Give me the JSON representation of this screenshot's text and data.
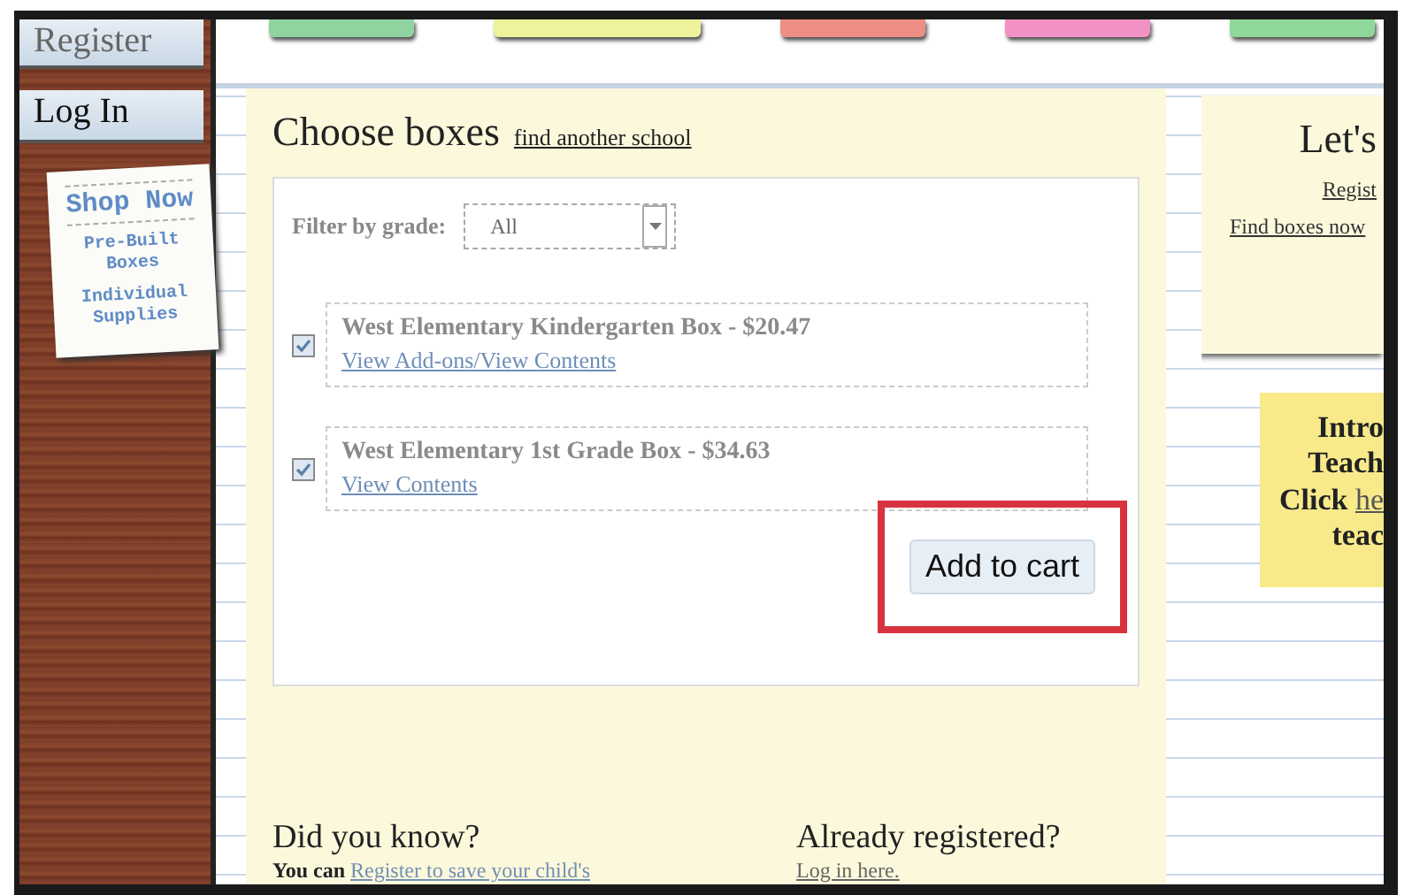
{
  "top_tabs": [
    {
      "color": "#8fd4a0"
    },
    {
      "color": "#eef29a"
    },
    {
      "color": "#ee8f86"
    },
    {
      "color": "#f191c4"
    },
    {
      "color": "#8fd89a"
    }
  ],
  "sidebar": {
    "buttons": [
      "Register",
      "Log In"
    ],
    "shop_card": {
      "title": "Shop Now",
      "links": [
        "Pre-Built Boxes",
        "Individual Supplies"
      ]
    }
  },
  "main": {
    "title": "Choose boxes",
    "title_link": "find another school",
    "filter": {
      "label": "Filter by grade:",
      "value": "All"
    },
    "items": [
      {
        "name": "West Elementary Kindergarten Box - $20.47",
        "link": "View Add-ons/View Contents",
        "checked": true
      },
      {
        "name": "West Elementary 1st Grade Box - $34.63",
        "link": "View Contents",
        "checked": true
      }
    ],
    "button": {
      "label": "Add to cart",
      "highlighted": true
    },
    "info": [
      {
        "heading": "Did you know?",
        "prefix": "You can",
        "link": "Register to save your child's"
      },
      {
        "heading": "Already registered?",
        "link": "Log in here."
      }
    ]
  },
  "right": {
    "card": {
      "title": "Let's",
      "links": [
        "Regist",
        "Find boxes now"
      ]
    },
    "sticky": [
      {
        "text": "Intro"
      },
      {
        "text": "Teach"
      },
      {
        "text": "Click ",
        "link": "he"
      },
      {
        "text": "teac"
      }
    ]
  }
}
